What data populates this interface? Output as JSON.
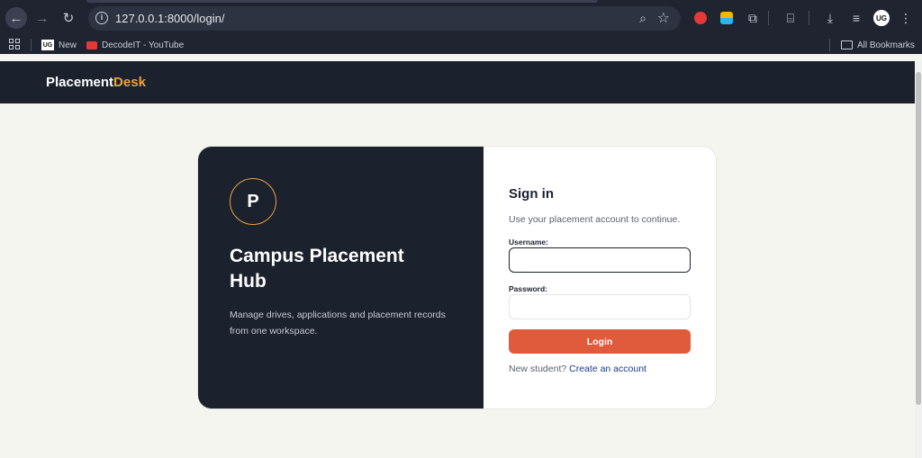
{
  "browser": {
    "url": "127.0.0.1:8000/login/",
    "bookmarks": [
      {
        "label": "New",
        "icon": "ug-icon"
      },
      {
        "label": "DecodeIT - YouTube",
        "icon": "youtube-icon"
      }
    ],
    "all_bookmarks_label": "All Bookmarks",
    "profile_initials": "UG",
    "new_bookmark_favicon_text": "UG"
  },
  "header": {
    "brand_main": "Placement",
    "brand_accent": "Desk"
  },
  "hero": {
    "logo_letter": "P",
    "title": "Campus Placement Hub",
    "description": "Manage drives, applications and placement records from one workspace."
  },
  "login": {
    "title": "Sign in",
    "subtitle": "Use your placement account to continue.",
    "username_label": "Username:",
    "username_value": "",
    "password_label": "Password:",
    "password_value": "",
    "submit_label": "Login",
    "signup_prompt": "New student?",
    "signup_link": "Create an account"
  },
  "colors": {
    "header_bg": "#1b212d",
    "accent_orange": "#e8a33f",
    "login_button": "#e05a3c",
    "link_blue": "#1e3a8a",
    "page_bg": "#f5f5f0"
  }
}
